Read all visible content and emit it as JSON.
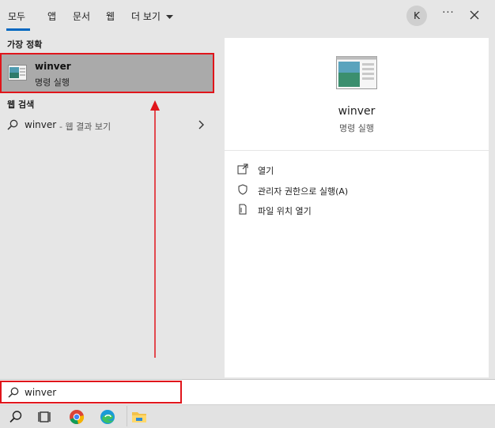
{
  "tabs": [
    {
      "label": "모두"
    },
    {
      "label": "앱"
    },
    {
      "label": "문서"
    },
    {
      "label": "웹"
    },
    {
      "label": "더 보기"
    }
  ],
  "account": {
    "initial": "K"
  },
  "more_label": "···",
  "sections": {
    "best_match": "가장 정확",
    "web_search": "웹 검색"
  },
  "best_match_item": {
    "title": "winver",
    "subtitle": "명령 실행"
  },
  "web_item": {
    "query": "winver",
    "suffix": "- 웹 결과 보기"
  },
  "preview": {
    "title": "winver",
    "subtitle": "명령 실행",
    "actions": [
      {
        "label": "열기",
        "icon": "open-icon"
      },
      {
        "label": "관리자 권한으로 실행(A)",
        "icon": "shield-icon"
      },
      {
        "label": "파일 위치 열기",
        "icon": "file-location-icon"
      }
    ]
  },
  "search": {
    "value": "winver"
  },
  "colors": {
    "highlight_border": "#e0151b",
    "accent": "#0067c0",
    "arrow": "#e0151b"
  },
  "taskbar": [
    "search-icon",
    "task-view-icon",
    "chrome-icon",
    "edge-icon",
    "file-explorer-icon"
  ]
}
